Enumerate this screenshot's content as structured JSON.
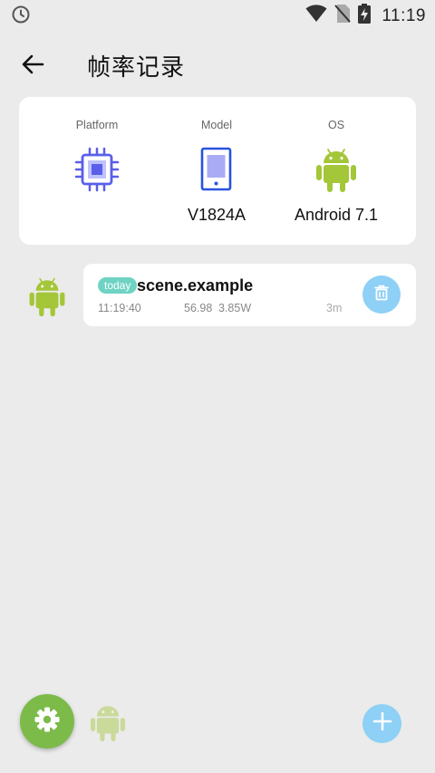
{
  "status_bar": {
    "time": "11:19"
  },
  "header": {
    "title": "帧率记录"
  },
  "device_info": {
    "platform": {
      "label": "Platform",
      "value": ""
    },
    "model": {
      "label": "Model",
      "value": "V1824A"
    },
    "os": {
      "label": "OS",
      "value": "Android 7.1"
    }
  },
  "records": [
    {
      "badge": "today",
      "title": "scene.example",
      "time": "11:19:40",
      "fps": "56.98",
      "power": "3.85W",
      "duration": "3m"
    }
  ],
  "colors": {
    "background": "#ebebeb",
    "card": "#ffffff",
    "android_green": "#a4c639",
    "platform_purple": "#5a5ee8",
    "model_blue": "#2a52e0",
    "badge_teal": "#6fd3c3",
    "fab_blue": "#8ed0f6",
    "settings_green": "#7cbb4a"
  },
  "icons": {
    "status_left": "clock-icon",
    "status_right": [
      "wifi-icon",
      "no-sim-icon",
      "battery-charging-icon"
    ],
    "back": "arrow-back-icon",
    "platform": "cpu-chip-icon",
    "model": "phone-icon",
    "os": "android-icon",
    "record_avatar": "android-icon",
    "delete": "trash-icon",
    "settings": "gear-icon",
    "add": "plus-icon"
  }
}
